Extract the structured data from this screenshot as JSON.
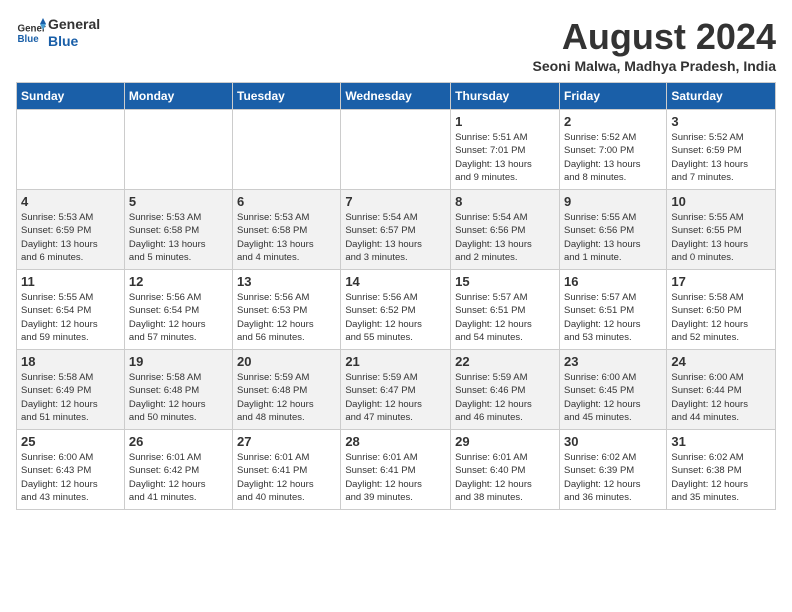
{
  "header": {
    "logo_line1": "General",
    "logo_line2": "Blue",
    "month_year": "August 2024",
    "location": "Seoni Malwa, Madhya Pradesh, India"
  },
  "days_of_week": [
    "Sunday",
    "Monday",
    "Tuesday",
    "Wednesday",
    "Thursday",
    "Friday",
    "Saturday"
  ],
  "weeks": [
    [
      {
        "day": "",
        "info": ""
      },
      {
        "day": "",
        "info": ""
      },
      {
        "day": "",
        "info": ""
      },
      {
        "day": "",
        "info": ""
      },
      {
        "day": "1",
        "info": "Sunrise: 5:51 AM\nSunset: 7:01 PM\nDaylight: 13 hours\nand 9 minutes."
      },
      {
        "day": "2",
        "info": "Sunrise: 5:52 AM\nSunset: 7:00 PM\nDaylight: 13 hours\nand 8 minutes."
      },
      {
        "day": "3",
        "info": "Sunrise: 5:52 AM\nSunset: 6:59 PM\nDaylight: 13 hours\nand 7 minutes."
      }
    ],
    [
      {
        "day": "4",
        "info": "Sunrise: 5:53 AM\nSunset: 6:59 PM\nDaylight: 13 hours\nand 6 minutes."
      },
      {
        "day": "5",
        "info": "Sunrise: 5:53 AM\nSunset: 6:58 PM\nDaylight: 13 hours\nand 5 minutes."
      },
      {
        "day": "6",
        "info": "Sunrise: 5:53 AM\nSunset: 6:58 PM\nDaylight: 13 hours\nand 4 minutes."
      },
      {
        "day": "7",
        "info": "Sunrise: 5:54 AM\nSunset: 6:57 PM\nDaylight: 13 hours\nand 3 minutes."
      },
      {
        "day": "8",
        "info": "Sunrise: 5:54 AM\nSunset: 6:56 PM\nDaylight: 13 hours\nand 2 minutes."
      },
      {
        "day": "9",
        "info": "Sunrise: 5:55 AM\nSunset: 6:56 PM\nDaylight: 13 hours\nand 1 minute."
      },
      {
        "day": "10",
        "info": "Sunrise: 5:55 AM\nSunset: 6:55 PM\nDaylight: 13 hours\nand 0 minutes."
      }
    ],
    [
      {
        "day": "11",
        "info": "Sunrise: 5:55 AM\nSunset: 6:54 PM\nDaylight: 12 hours\nand 59 minutes."
      },
      {
        "day": "12",
        "info": "Sunrise: 5:56 AM\nSunset: 6:54 PM\nDaylight: 12 hours\nand 57 minutes."
      },
      {
        "day": "13",
        "info": "Sunrise: 5:56 AM\nSunset: 6:53 PM\nDaylight: 12 hours\nand 56 minutes."
      },
      {
        "day": "14",
        "info": "Sunrise: 5:56 AM\nSunset: 6:52 PM\nDaylight: 12 hours\nand 55 minutes."
      },
      {
        "day": "15",
        "info": "Sunrise: 5:57 AM\nSunset: 6:51 PM\nDaylight: 12 hours\nand 54 minutes."
      },
      {
        "day": "16",
        "info": "Sunrise: 5:57 AM\nSunset: 6:51 PM\nDaylight: 12 hours\nand 53 minutes."
      },
      {
        "day": "17",
        "info": "Sunrise: 5:58 AM\nSunset: 6:50 PM\nDaylight: 12 hours\nand 52 minutes."
      }
    ],
    [
      {
        "day": "18",
        "info": "Sunrise: 5:58 AM\nSunset: 6:49 PM\nDaylight: 12 hours\nand 51 minutes."
      },
      {
        "day": "19",
        "info": "Sunrise: 5:58 AM\nSunset: 6:48 PM\nDaylight: 12 hours\nand 50 minutes."
      },
      {
        "day": "20",
        "info": "Sunrise: 5:59 AM\nSunset: 6:48 PM\nDaylight: 12 hours\nand 48 minutes."
      },
      {
        "day": "21",
        "info": "Sunrise: 5:59 AM\nSunset: 6:47 PM\nDaylight: 12 hours\nand 47 minutes."
      },
      {
        "day": "22",
        "info": "Sunrise: 5:59 AM\nSunset: 6:46 PM\nDaylight: 12 hours\nand 46 minutes."
      },
      {
        "day": "23",
        "info": "Sunrise: 6:00 AM\nSunset: 6:45 PM\nDaylight: 12 hours\nand 45 minutes."
      },
      {
        "day": "24",
        "info": "Sunrise: 6:00 AM\nSunset: 6:44 PM\nDaylight: 12 hours\nand 44 minutes."
      }
    ],
    [
      {
        "day": "25",
        "info": "Sunrise: 6:00 AM\nSunset: 6:43 PM\nDaylight: 12 hours\nand 43 minutes."
      },
      {
        "day": "26",
        "info": "Sunrise: 6:01 AM\nSunset: 6:42 PM\nDaylight: 12 hours\nand 41 minutes."
      },
      {
        "day": "27",
        "info": "Sunrise: 6:01 AM\nSunset: 6:41 PM\nDaylight: 12 hours\nand 40 minutes."
      },
      {
        "day": "28",
        "info": "Sunrise: 6:01 AM\nSunset: 6:41 PM\nDaylight: 12 hours\nand 39 minutes."
      },
      {
        "day": "29",
        "info": "Sunrise: 6:01 AM\nSunset: 6:40 PM\nDaylight: 12 hours\nand 38 minutes."
      },
      {
        "day": "30",
        "info": "Sunrise: 6:02 AM\nSunset: 6:39 PM\nDaylight: 12 hours\nand 36 minutes."
      },
      {
        "day": "31",
        "info": "Sunrise: 6:02 AM\nSunset: 6:38 PM\nDaylight: 12 hours\nand 35 minutes."
      }
    ]
  ]
}
